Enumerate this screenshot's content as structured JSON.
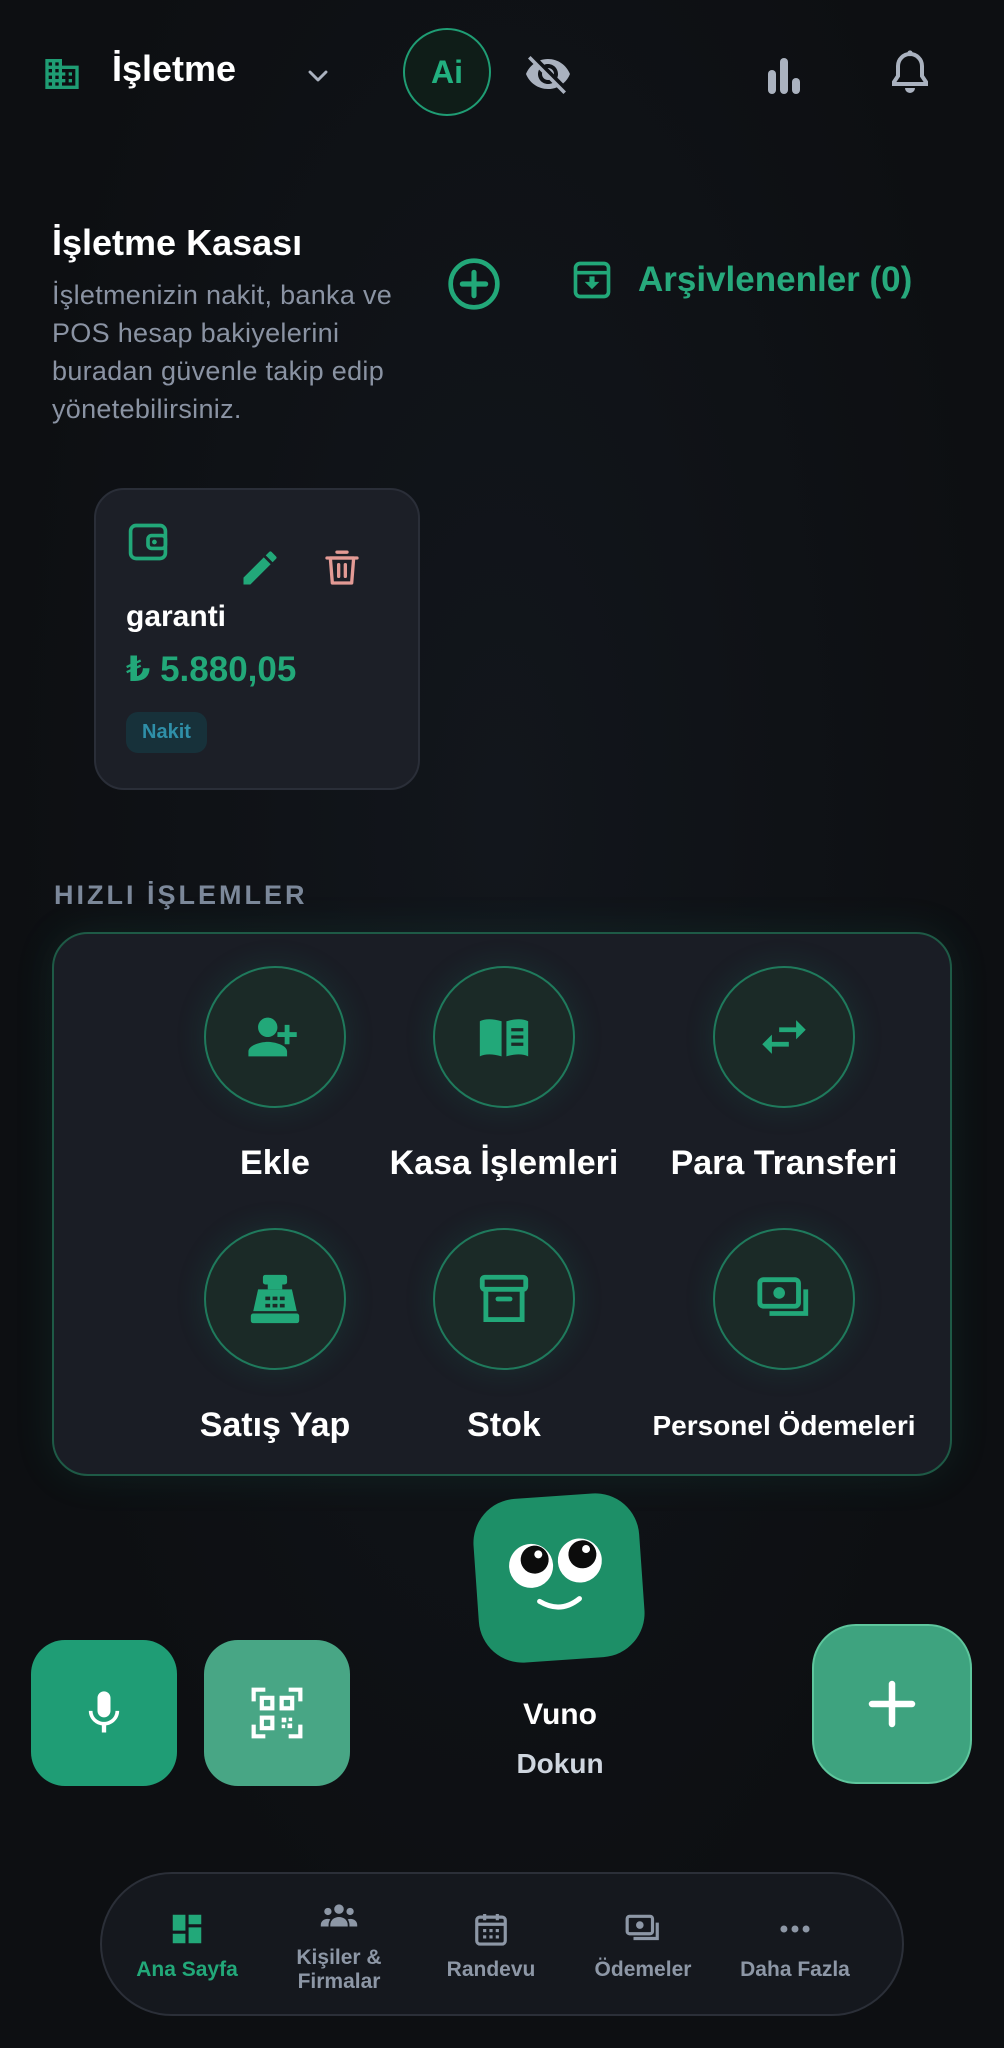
{
  "header": {
    "business_title": "İşletme",
    "ai_label": "Ai"
  },
  "section": {
    "title": "İşletme Kasası",
    "description": "İşletmenizin nakit, banka ve POS hesap bakiyelerini buradan güvenle takip edip yönetebilirsiniz.",
    "archive_label": "Arşivlenenler (0)"
  },
  "account": {
    "name": "garanti",
    "balance": "₺ 5.880,05",
    "type_badge": "Nakit"
  },
  "quick_actions": {
    "title": "HIZLI İŞLEMLER",
    "items": [
      {
        "label": "Ekle",
        "icon": "person-add-icon"
      },
      {
        "label": "Kasa İşlemleri",
        "icon": "book-icon"
      },
      {
        "label": "Para Transferi",
        "icon": "transfer-icon"
      },
      {
        "label": "Satış Yap",
        "icon": "cash-register-icon"
      },
      {
        "label": "Stok",
        "icon": "archive-box-icon"
      },
      {
        "label": "Personel Ödemeleri",
        "icon": "payments-icon"
      }
    ]
  },
  "assistant": {
    "name": "Vuno",
    "action": "Dokun"
  },
  "bottom_nav": {
    "items": [
      {
        "label": "Ana Sayfa",
        "icon": "dashboard-icon",
        "active": true
      },
      {
        "label": "Kişiler & Firmalar",
        "icon": "people-icon",
        "active": false
      },
      {
        "label": "Randevu",
        "icon": "calendar-icon",
        "active": false
      },
      {
        "label": "Ödemeler",
        "icon": "payments-icon",
        "active": false
      },
      {
        "label": "Daha Fazla",
        "icon": "more-icon",
        "active": false
      }
    ]
  },
  "colors": {
    "accent": "#22a879",
    "background": "#0d0f12",
    "card": "#1c1f27"
  }
}
